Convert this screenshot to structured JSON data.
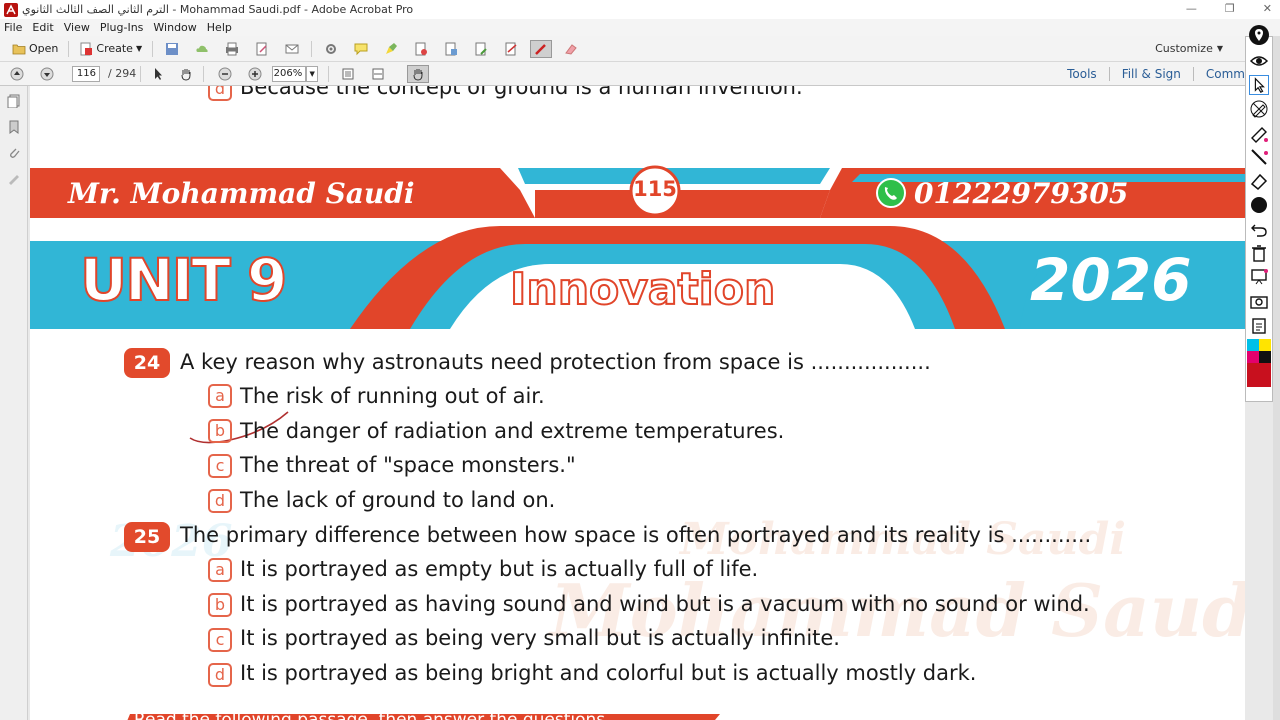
{
  "window": {
    "title": "الترم الثاني الصف الثالث الثانوي - Mohammad Saudi.pdf - Adobe Acrobat Pro",
    "controls": [
      "—",
      "❐",
      "✕"
    ]
  },
  "menu": [
    "File",
    "Edit",
    "View",
    "Plug-Ins",
    "Window",
    "Help"
  ],
  "toolbar": {
    "open_label": "Open",
    "create_label": "Create",
    "customize_label": "Customize",
    "page_current": "116",
    "page_total": "/ 294",
    "zoom": "206%",
    "links": [
      "Tools",
      "Fill & Sign",
      "Comm"
    ]
  },
  "banner": {
    "teacher": "Mr. Mohammad Saudi",
    "page_badge": "115",
    "phone": "01222979305",
    "unit": "UNIT 9",
    "unit_title": "Innovation",
    "year": "2026"
  },
  "top_cut_option": {
    "letter": "d",
    "text": "Because the concept of ground is a human invention."
  },
  "questions": [
    {
      "number": "24",
      "text": "A key reason why astronauts need protection from space is ..................",
      "options": [
        {
          "letter": "a",
          "text": "The risk of running out of air."
        },
        {
          "letter": "b",
          "text": "The danger of radiation and extreme temperatures."
        },
        {
          "letter": "c",
          "text": "The threat of \"space monsters.\""
        },
        {
          "letter": "d",
          "text": "The lack of ground to land on."
        }
      ]
    },
    {
      "number": "25",
      "text": "The primary difference between how space is often portrayed and its reality is ............",
      "options": [
        {
          "letter": "a",
          "text": "It is portrayed as empty but is actually full of life."
        },
        {
          "letter": "b",
          "text": "It is portrayed as having sound and wind but is a vacuum with no sound or wind."
        },
        {
          "letter": "c",
          "text": "It is portrayed as being very small but is actually infinite."
        },
        {
          "letter": "d",
          "text": "It is portrayed as being bright and colorful but is actually mostly dark."
        }
      ]
    }
  ],
  "bottom_cut_text": "Read the following passage, then answer the questions",
  "watermark": {
    "line1": "Mohammad Saudi",
    "line2": "Mohammad Saudi",
    "year": "2026"
  },
  "colors": {
    "red": "#e1452a",
    "cyan": "#31b6d6",
    "ink": "#b03030"
  }
}
